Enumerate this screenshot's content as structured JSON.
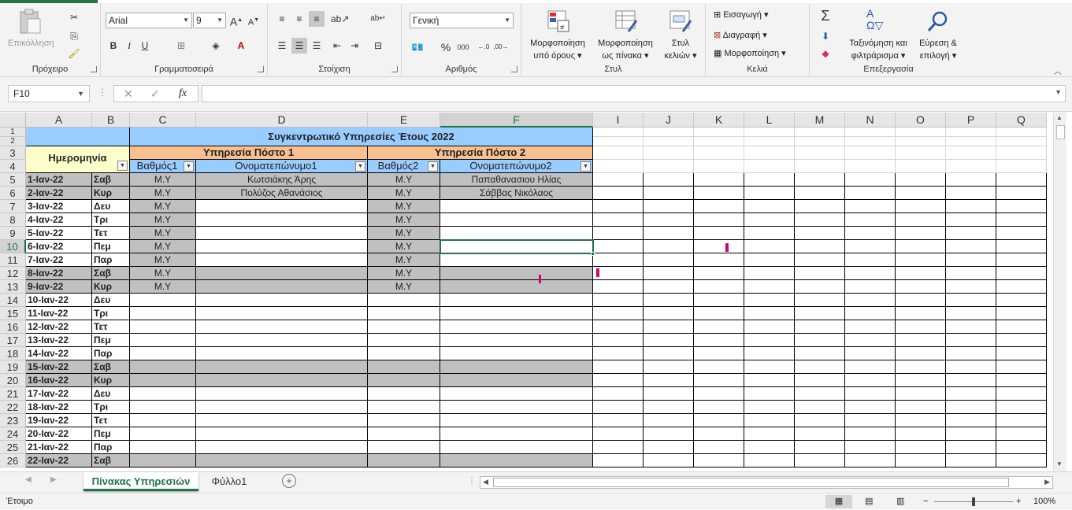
{
  "ribbon": {
    "clipboard": {
      "label": "Πρόχειρο",
      "paste_label": "Επικόλληση"
    },
    "font": {
      "label": "Γραμματοσειρά",
      "font_name": "Arial",
      "font_size": "9"
    },
    "alignment": {
      "label": "Στοίχιση"
    },
    "number": {
      "label": "Αριθμός",
      "format": "Γενική"
    },
    "styles": {
      "label": "Στυλ",
      "cond_format": [
        "Μορφοποίηση",
        "υπό όρους"
      ],
      "format_table": [
        "Μορφοποίηση",
        "ως πίνακα"
      ],
      "cell_styles": [
        "Στυλ",
        "κελιών"
      ]
    },
    "cells": {
      "label": "Κελιά",
      "insert": "Εισαγωγή",
      "delete": "Διαγραφή",
      "format": "Μορφοποίηση"
    },
    "editing": {
      "label": "Επεξεργασία",
      "sort_filter": [
        "Ταξινόμηση και",
        "φιλτράρισμα"
      ],
      "find_select": [
        "Εύρεση &",
        "επιλογή"
      ]
    }
  },
  "formula_bar": {
    "name_box": "F10",
    "formula": ""
  },
  "columns": [
    "A",
    "B",
    "C",
    "D",
    "E",
    "F",
    "I",
    "J",
    "K",
    "L",
    "M",
    "N",
    "O",
    "P",
    "Q"
  ],
  "sheet": {
    "title": "Συγκεντρωτικό Υπηρεσίες Έτους 2022",
    "post1": "Υπηρεσία Πόστο 1",
    "post2": "Υπηρεσία Πόστο 2",
    "date_header": "Ημερομηνία",
    "grade1": "Βαθμός1",
    "name1": "Ονοματεπώνυμο1",
    "grade2": "Βαθμός2",
    "name2": "Ονοματεπώνυμο2",
    "rows": [
      {
        "n": "5",
        "date": "1-Ιαν-22",
        "day": "Σαβ",
        "g1": "Μ.Υ",
        "n1": "Κωτσιάκης Άρης",
        "g2": "Μ.Υ",
        "n2": "Παπαθανασιου Ηλίας",
        "we": true
      },
      {
        "n": "6",
        "date": "2-Ιαν-22",
        "day": "Κυρ",
        "g1": "Μ.Υ",
        "n1": "Πολύζος Αθανάσιος",
        "g2": "Μ.Υ",
        "n2": "Σάββας Νικόλαος",
        "we": true
      },
      {
        "n": "7",
        "date": "3-Ιαν-22",
        "day": "Δευ",
        "g1": "Μ.Υ",
        "n1": "",
        "g2": "Μ.Υ",
        "n2": "",
        "we": false
      },
      {
        "n": "8",
        "date": "4-Ιαν-22",
        "day": "Τρι",
        "g1": "Μ.Υ",
        "n1": "",
        "g2": "Μ.Υ",
        "n2": "",
        "we": false
      },
      {
        "n": "9",
        "date": "5-Ιαν-22",
        "day": "Τετ",
        "g1": "Μ.Υ",
        "n1": "",
        "g2": "Μ.Υ",
        "n2": "",
        "we": false
      },
      {
        "n": "10",
        "date": "6-Ιαν-22",
        "day": "Πεμ",
        "g1": "Μ.Υ",
        "n1": "",
        "g2": "Μ.Υ",
        "n2": "",
        "we": false
      },
      {
        "n": "11",
        "date": "7-Ιαν-22",
        "day": "Παρ",
        "g1": "Μ.Υ",
        "n1": "",
        "g2": "Μ.Υ",
        "n2": "",
        "we": false
      },
      {
        "n": "12",
        "date": "8-Ιαν-22",
        "day": "Σαβ",
        "g1": "Μ.Υ",
        "n1": "",
        "g2": "Μ.Υ",
        "n2": "",
        "we": true
      },
      {
        "n": "13",
        "date": "9-Ιαν-22",
        "day": "Κυρ",
        "g1": "Μ.Υ",
        "n1": "",
        "g2": "Μ.Υ",
        "n2": "",
        "we": true
      },
      {
        "n": "14",
        "date": "10-Ιαν-22",
        "day": "Δευ",
        "g1": "",
        "n1": "",
        "g2": "",
        "n2": "",
        "we": false
      },
      {
        "n": "15",
        "date": "11-Ιαν-22",
        "day": "Τρι",
        "g1": "",
        "n1": "",
        "g2": "",
        "n2": "",
        "we": false
      },
      {
        "n": "16",
        "date": "12-Ιαν-22",
        "day": "Τετ",
        "g1": "",
        "n1": "",
        "g2": "",
        "n2": "",
        "we": false
      },
      {
        "n": "17",
        "date": "13-Ιαν-22",
        "day": "Πεμ",
        "g1": "",
        "n1": "",
        "g2": "",
        "n2": "",
        "we": false
      },
      {
        "n": "18",
        "date": "14-Ιαν-22",
        "day": "Παρ",
        "g1": "",
        "n1": "",
        "g2": "",
        "n2": "",
        "we": false
      },
      {
        "n": "19",
        "date": "15-Ιαν-22",
        "day": "Σαβ",
        "g1": "",
        "n1": "",
        "g2": "",
        "n2": "",
        "we": true
      },
      {
        "n": "20",
        "date": "16-Ιαν-22",
        "day": "Κυρ",
        "g1": "",
        "n1": "",
        "g2": "",
        "n2": "",
        "we": true
      },
      {
        "n": "21",
        "date": "17-Ιαν-22",
        "day": "Δευ",
        "g1": "",
        "n1": "",
        "g2": "",
        "n2": "",
        "we": false
      },
      {
        "n": "22",
        "date": "18-Ιαν-22",
        "day": "Τρι",
        "g1": "",
        "n1": "",
        "g2": "",
        "n2": "",
        "we": false
      },
      {
        "n": "23",
        "date": "19-Ιαν-22",
        "day": "Τετ",
        "g1": "",
        "n1": "",
        "g2": "",
        "n2": "",
        "we": false
      },
      {
        "n": "24",
        "date": "20-Ιαν-22",
        "day": "Πεμ",
        "g1": "",
        "n1": "",
        "g2": "",
        "n2": "",
        "we": false
      },
      {
        "n": "25",
        "date": "21-Ιαν-22",
        "day": "Παρ",
        "g1": "",
        "n1": "",
        "g2": "",
        "n2": "",
        "we": false
      },
      {
        "n": "26",
        "date": "22-Ιαν-22",
        "day": "Σαβ",
        "g1": "",
        "n1": "",
        "g2": "",
        "n2": "",
        "we": true
      }
    ]
  },
  "tabs": [
    {
      "label": "Πίνακας Υπηρεσιών",
      "active": true
    },
    {
      "label": "Φύλλο1",
      "active": false
    }
  ],
  "status": {
    "text": "Έτοιμο",
    "zoom": "100%"
  },
  "colors": {
    "accent": "#217346",
    "header_blue": "#99ccff",
    "post_orange": "#fac090",
    "date_yellow": "#ffffcc",
    "weekend_gray": "#c0c0c0"
  }
}
